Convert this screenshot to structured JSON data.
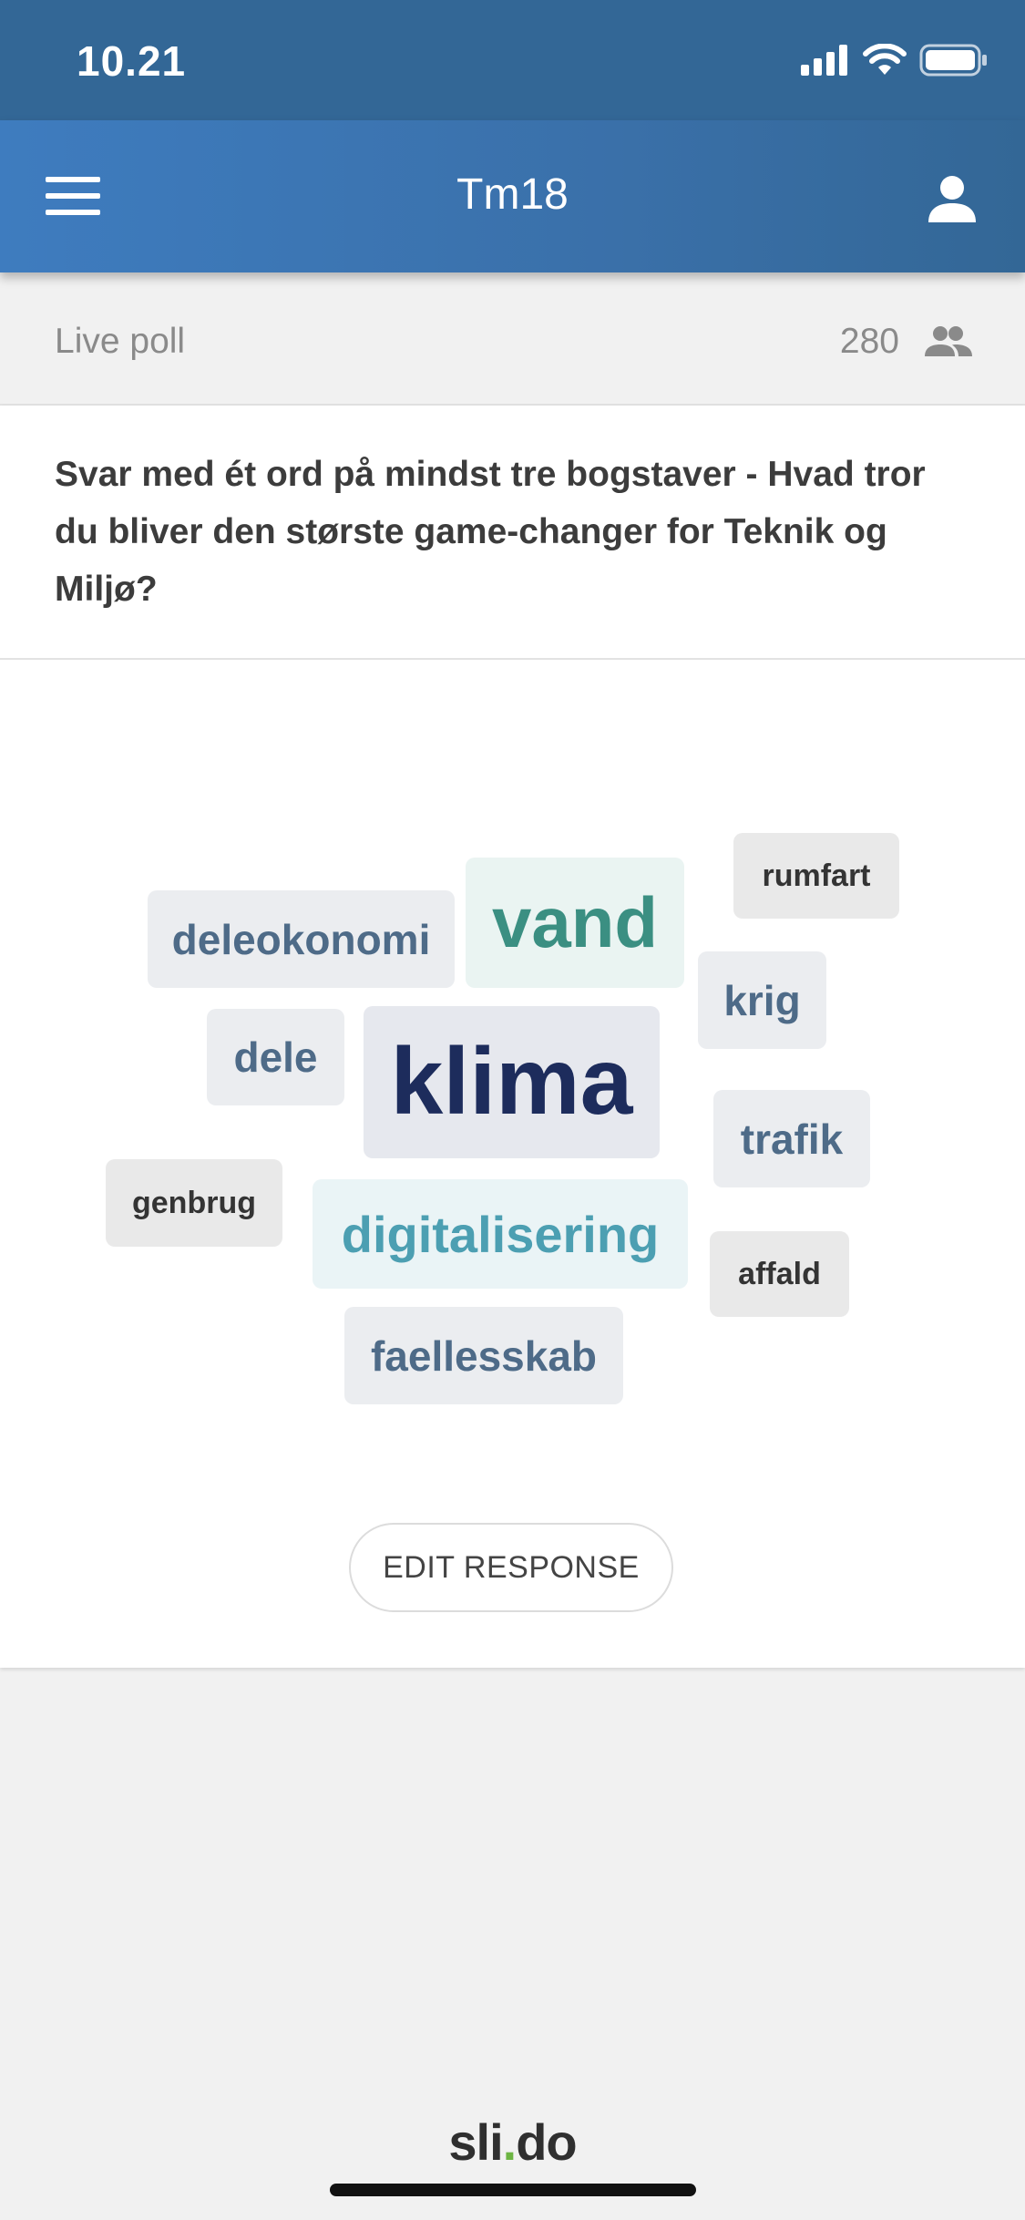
{
  "status_bar": {
    "time": "10.21"
  },
  "app_bar": {
    "title": "Tm18",
    "menu_icon": "hamburger-menu-icon",
    "user_icon": "user-icon"
  },
  "poll": {
    "label": "Live poll",
    "participant_count": "280",
    "participants_icon": "people-icon",
    "question": "Svar med ét ord på mindst tre bogstaver - Hvad tror du bliver den største game-changer for Teknik og Miljø?",
    "edit_response_label": "EDIT RESPONSE"
  },
  "word_cloud": {
    "words": {
      "rumfart": "rumfart",
      "deleokonomi": "deleokonomi",
      "vand": "vand",
      "krig": "krig",
      "dele": "dele",
      "klima": "klima",
      "trafik": "trafik",
      "genbrug": "genbrug",
      "digitalisering": "digitalisering",
      "affald": "affald",
      "faellesskab": "faellesskab"
    }
  },
  "footer": {
    "brand_prefix": "sli",
    "brand_dot": ".",
    "brand_suffix": "do"
  },
  "colors": {
    "status_bar": "#336796",
    "app_bar": "#3e7cbf",
    "brand_dot": "#6db543"
  }
}
